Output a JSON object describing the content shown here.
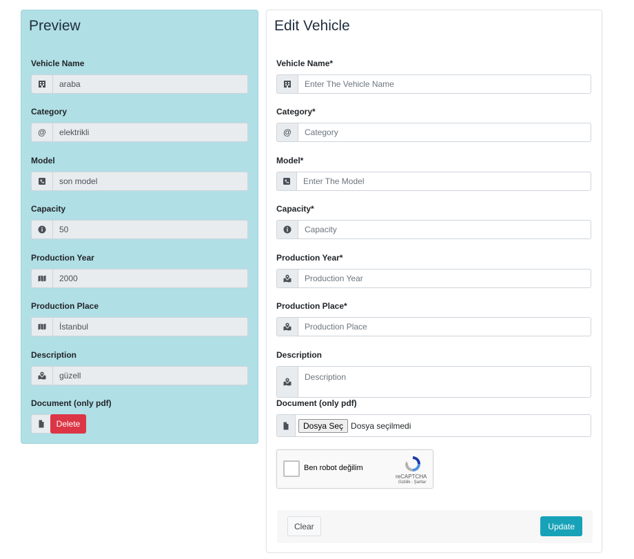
{
  "preview": {
    "title": "Preview",
    "fields": [
      {
        "label": "Vehicle Name",
        "value": "araba",
        "icon": "building-icon"
      },
      {
        "label": "Category",
        "value": "elektrikli",
        "icon": "at-icon"
      },
      {
        "label": "Model",
        "value": "son model",
        "icon": "phone-square-icon"
      },
      {
        "label": "Capacity",
        "value": "50",
        "icon": "info-circle-icon"
      },
      {
        "label": "Production Year",
        "value": "2000",
        "icon": "map-icon"
      },
      {
        "label": "Production Place",
        "value": "İstanbul",
        "icon": "map-icon"
      },
      {
        "label": "Description",
        "value": "güzell",
        "icon": "map-marked-icon"
      }
    ],
    "document": {
      "label": "Document (only pdf)",
      "delete_label": "Delete",
      "icon": "file-icon"
    }
  },
  "edit": {
    "title": "Edit Vehicle",
    "fields": [
      {
        "label": "Vehicle Name*",
        "placeholder": "Enter The Vehicle Name",
        "icon": "building-icon"
      },
      {
        "label": "Category*",
        "placeholder": "Category",
        "icon": "at-icon"
      },
      {
        "label": "Model*",
        "placeholder": "Enter The Model",
        "icon": "phone-square-icon"
      },
      {
        "label": "Capacity*",
        "placeholder": "Capacity",
        "icon": "info-circle-icon"
      },
      {
        "label": "Production Year*",
        "placeholder": "Production Year",
        "icon": "map-marked-icon"
      },
      {
        "label": "Production Place*",
        "placeholder": "Production Place",
        "icon": "map-marked-icon"
      },
      {
        "label": "Description",
        "placeholder": "Description",
        "icon": "map-marked-icon"
      }
    ],
    "document": {
      "label": "Document (only pdf)",
      "choose_label": "Dosya Seç",
      "no_file_label": "Dosya seçilmedi",
      "icon": "file-icon"
    },
    "recaptcha": {
      "label": "Ben robot değilim",
      "brand": "reCAPTCHA",
      "links": "Gizlilik - Şartlar"
    },
    "buttons": {
      "clear": "Clear",
      "update": "Update"
    }
  },
  "colors": {
    "preview_bg": "#b0dfe5",
    "delete": "#dc3545",
    "update": "#17a2b8"
  }
}
